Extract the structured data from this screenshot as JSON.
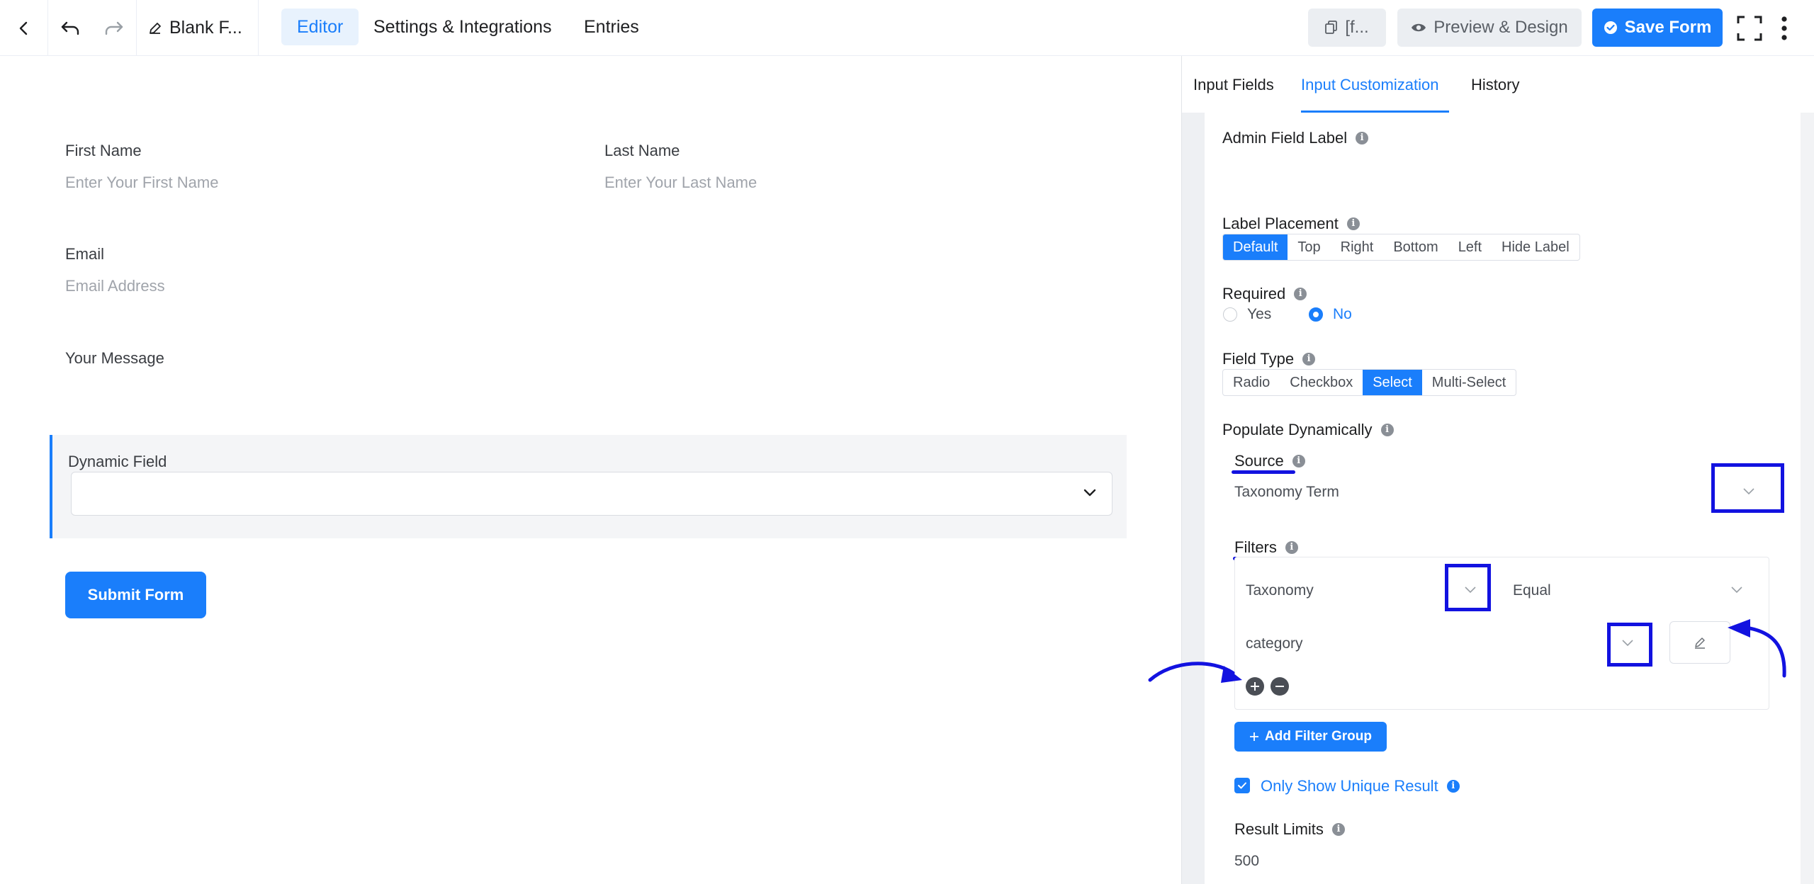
{
  "topbar": {
    "title": "Blank F...",
    "tabs": [
      "Editor",
      "Settings & Integrations",
      "Entries"
    ],
    "shortcode_label": "[f...",
    "preview_label": "Preview & Design",
    "save_label": "Save Form"
  },
  "form": {
    "first_name_label": "First Name",
    "first_name_placeholder": "Enter Your First Name",
    "last_name_label": "Last Name",
    "last_name_placeholder": "Enter Your Last Name",
    "email_label": "Email",
    "email_placeholder": "Email Address",
    "message_label": "Your Message",
    "dynamic_label": "Dynamic Field",
    "submit_label": "Submit Form"
  },
  "panel": {
    "tabs": [
      "Input Fields",
      "Input Customization",
      "History"
    ],
    "admin_field_label": "Admin Field Label",
    "label_placement": "Label Placement",
    "placement_options": [
      "Default",
      "Top",
      "Right",
      "Bottom",
      "Left",
      "Hide Label"
    ],
    "required": "Required",
    "required_yes": "Yes",
    "required_no": "No",
    "field_type": "Field Type",
    "field_type_options": [
      "Radio",
      "Checkbox",
      "Select",
      "Multi-Select"
    ],
    "populate_dynamically": "Populate Dynamically",
    "source": "Source",
    "source_value": "Taxonomy Term",
    "filters": "Filters",
    "filter_field": "Taxonomy",
    "filter_operator": "Equal",
    "filter_value": "category",
    "add_filter_group": "Add Filter Group",
    "unique_result": "Only Show Unique Result",
    "result_limits": "Result Limits",
    "result_limits_value": "500"
  },
  "colors": {
    "accent": "#1a7efb",
    "annotation": "#1212e0"
  },
  "icons": [
    "back-icon",
    "undo-icon",
    "redo-icon",
    "pencil-icon",
    "copy-icon",
    "eye-icon",
    "check-circle-icon",
    "fullscreen-icon",
    "more-vertical-icon",
    "chevron-down-icon",
    "edit-icon",
    "plus-icon",
    "minus-icon",
    "info-icon"
  ]
}
